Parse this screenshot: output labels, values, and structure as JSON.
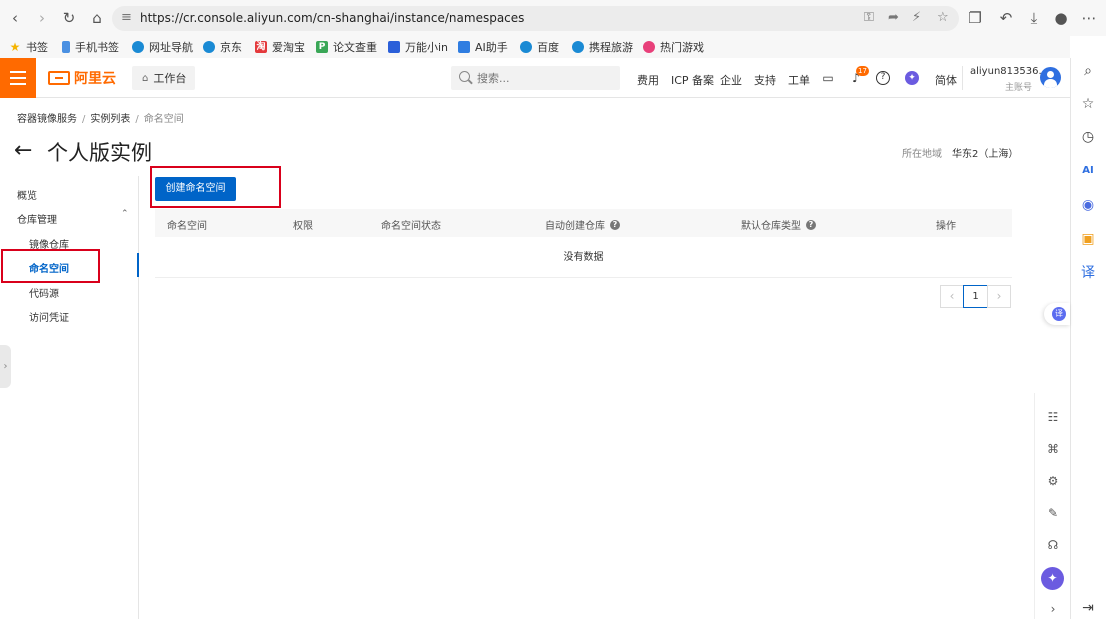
{
  "browser": {
    "url": "https://cr.console.aliyun.com/cn-shanghai/instance/namespaces",
    "bookmarks": [
      "书签",
      "手机书签",
      "网址导航",
      "京东",
      "爱淘宝",
      "论文查重",
      "万能小in",
      "AI助手",
      "百度",
      "携程旅游",
      "热门游戏"
    ]
  },
  "console": {
    "logo": "阿里云",
    "workbench": "工作台",
    "search_placeholder": "搜索...",
    "links": [
      "费用",
      "ICP 备案",
      "企业",
      "支持",
      "工单"
    ],
    "notification_count": "17",
    "language": "简体",
    "account_name": "aliyun813536...",
    "account_role": "主账号"
  },
  "breadcrumb": [
    "容器镜像服务",
    "实例列表",
    "命名空间"
  ],
  "page": {
    "title": "个人版实例",
    "region_label": "所在地域",
    "region_value": "华东2（上海）"
  },
  "left_nav": {
    "overview": "概览",
    "repo_mgmt": "仓库管理",
    "items": [
      "镜像仓库",
      "命名空间",
      "代码源",
      "访问凭证"
    ]
  },
  "toolbar": {
    "create_label": "创建命名空间"
  },
  "table": {
    "columns": [
      "命名空间",
      "权限",
      "命名空间状态",
      "自动创建仓库",
      "默认仓库类型",
      "操作"
    ],
    "empty_text": "没有数据"
  },
  "pagination": {
    "current_page": "1"
  },
  "colors": {
    "brand": "#ff6a00",
    "primary": "#0064c8",
    "highlight": "#d9001b"
  }
}
